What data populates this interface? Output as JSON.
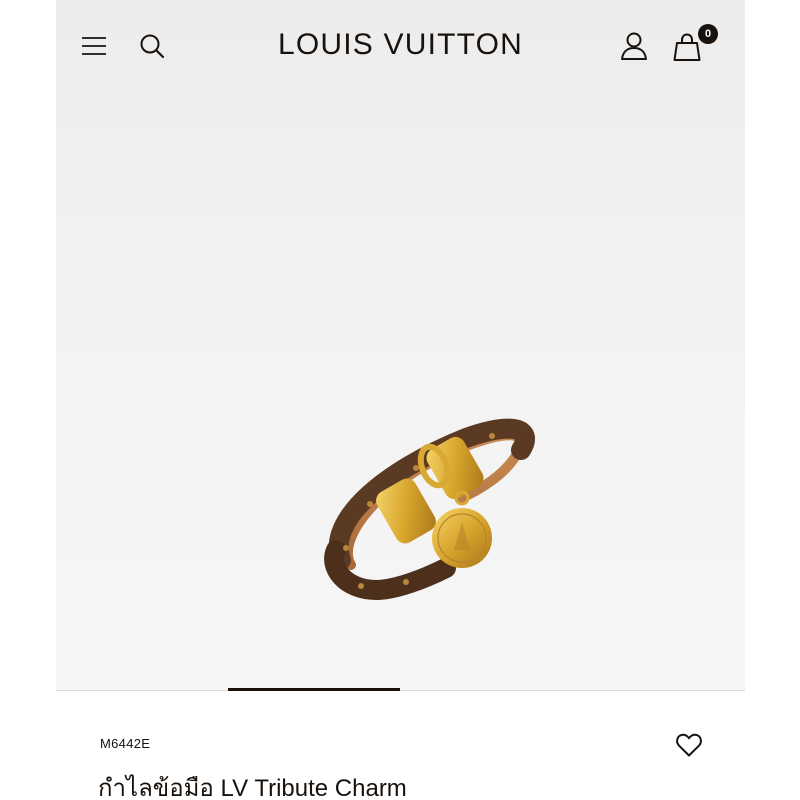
{
  "header": {
    "brand": "LOUIS VUITTON",
    "bag_count": "0",
    "icons": [
      "menu-icon",
      "search-icon",
      "account-icon",
      "shopping-bag-icon"
    ]
  },
  "carousel": {
    "active_index": 1,
    "total": 4
  },
  "product": {
    "sku": "M6442E",
    "title": "กำไลข้อมือ LV Tribute Charm",
    "image": "bracelet-image",
    "wishlist_icon": "heart-icon"
  },
  "colors": {
    "text": "#19110b",
    "hero_background": "#efefef",
    "leather_brown": "#5b3a24",
    "gold": "#d4a935"
  }
}
